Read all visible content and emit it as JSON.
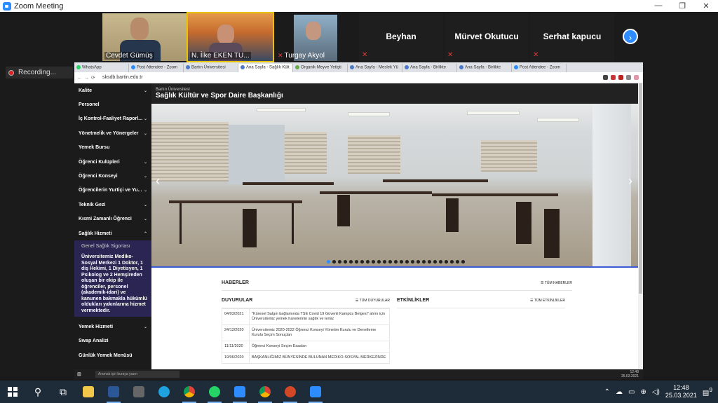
{
  "window": {
    "title": "Zoom Meeting",
    "controls": [
      "—",
      "❐",
      "✕"
    ]
  },
  "participants": [
    {
      "name": "Cevdet Gümüş",
      "muted": false
    },
    {
      "name": "N. İlke EKEN TU...",
      "muted": false
    },
    {
      "name": "Turgay Akyol",
      "muted": true
    },
    {
      "name": "Beyhan",
      "muted": true
    },
    {
      "name": "Mürvet Okutucu",
      "muted": true
    },
    {
      "name": "Serhat  kapucu",
      "muted": true
    }
  ],
  "next_button": "›",
  "recording": "Recording...",
  "browser": {
    "tabs": [
      "WhatsApp",
      "Post Attendee - Zoom",
      "Bartın Üniversitesi",
      "Ana Sayfa - Sağlık Kült",
      "Organik Meyve Yetişti",
      "Ana Sayfa - Meslek Yü",
      "Ana Sayfa - Birlikte",
      "Ana Sayfa - Birlikte",
      "Post Attendee - Zoom"
    ],
    "url": "sksdb.bartin.edu.tr"
  },
  "site": {
    "university": "Bartın Üniversitesi",
    "department": "Sağlık Kültür ve Spor Daire Başkanlığı",
    "menu": [
      {
        "label": "Kalite",
        "chev": true
      },
      {
        "label": "Personel",
        "chev": false
      },
      {
        "label": "İç Kontrol-Faaliyet Raporl...",
        "chev": true
      },
      {
        "label": "Yönetmelik ve Yönergeler",
        "chev": true
      },
      {
        "label": "Yemek Bursu",
        "chev": false
      },
      {
        "label": "Öğrenci Kulüpleri",
        "chev": true
      },
      {
        "label": "Öğrenci Konseyi",
        "chev": true
      },
      {
        "label": "Öğrencilerin Yurtiçi ve Yu...",
        "chev": true
      },
      {
        "label": "Teknik Gezi",
        "chev": true
      },
      {
        "label": "Kısmi Zamanlı Öğrenci",
        "chev": true
      },
      {
        "label": "Sağlık Hizmeti",
        "chev": true
      }
    ],
    "submenu": {
      "head": "Genel Sağlık Sigortası",
      "para": "Üniversitemiz Mediko-Sosyal Merkezi 1 Doktor, 1 diş Hekimi, 1 Diyetisyen, 1 Psikolog ve 2 Hemşireden oluşan bir ekip ile öğrenciler, personel (akademik-idari) ve kanunen bakmakla hükümlü oldukları yakınlarına hizmet vermektedir."
    },
    "menu2": [
      {
        "label": "Yemek Hizmeti",
        "chev": true
      },
      {
        "label": "Swap Analizi",
        "chev": false
      },
      {
        "label": "Günlük Yemek Menüsü",
        "chev": false
      }
    ],
    "news": {
      "title": "HABERLER",
      "all": "TÜM HABERLER"
    },
    "announcements": {
      "title": "DUYURULAR",
      "all": "TÜM DUYURULAR",
      "rows": [
        {
          "date": "04/03/2021",
          "text": "\"Küresel Salgın bağlamında TSE Covid 19 Güvenli Kampüs Belgesi\" alımı için Üniversitemiz yemek hanelerinin sağlık ve temiz"
        },
        {
          "date": "24/12/2020",
          "text": "Üniversitemiz 2020-2022 Öğrenci Konseyi Yönetim Kurulu ve Denetleme Kurulu Seçim Sonuçları"
        },
        {
          "date": "11/11/2020",
          "text": "Öğrenci Konseyi Seçim Esasları"
        },
        {
          "date": "19/06/2020",
          "text": "BAŞKANLIĞIMIZ BÜNYESİNDE BULUNAN MEDİKO-SOSYAL MERKEZİNDE"
        }
      ]
    },
    "events": {
      "title": "ETKİNLİKLER",
      "all": "TÜM ETKİNLİKLER"
    }
  },
  "inner_taskbar": {
    "search": "Aramak için buraya yazın",
    "time": "12:48",
    "date": "25.03.2021"
  },
  "taskbar": {
    "search_placeholder": "Aramak için buraya yazın",
    "time": "12:48",
    "date": "25.03.2021",
    "notif_count": "9"
  },
  "colors": {
    "zoom_blue": "#2d8cff",
    "sidebar_bg": "#1b1b1b",
    "submenu_bg": "#2b2553",
    "accent": "#3b5bd6"
  }
}
